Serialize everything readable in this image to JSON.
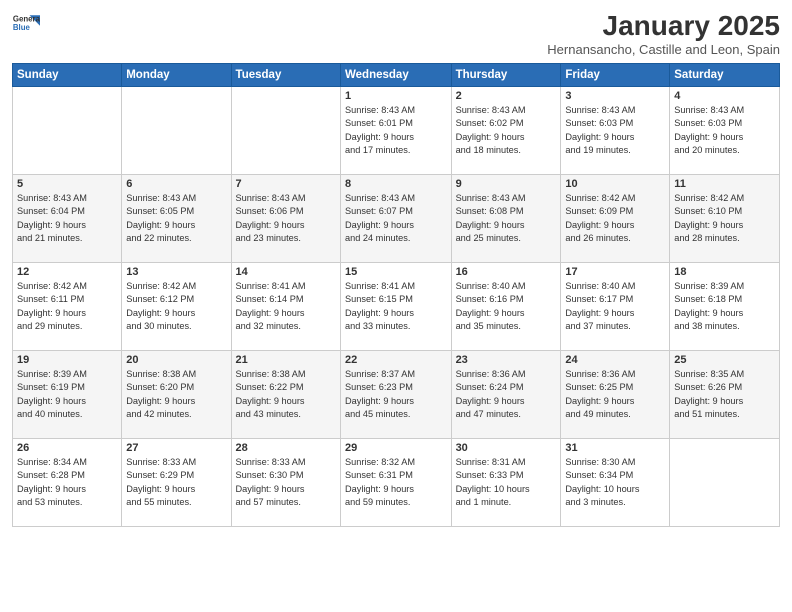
{
  "logo": {
    "line1": "General",
    "line2": "Blue"
  },
  "header": {
    "title": "January 2025",
    "location": "Hernansancho, Castille and Leon, Spain"
  },
  "weekdays": [
    "Sunday",
    "Monday",
    "Tuesday",
    "Wednesday",
    "Thursday",
    "Friday",
    "Saturday"
  ],
  "weeks": [
    [
      {
        "day": "",
        "info": ""
      },
      {
        "day": "",
        "info": ""
      },
      {
        "day": "",
        "info": ""
      },
      {
        "day": "1",
        "info": "Sunrise: 8:43 AM\nSunset: 6:01 PM\nDaylight: 9 hours\nand 17 minutes."
      },
      {
        "day": "2",
        "info": "Sunrise: 8:43 AM\nSunset: 6:02 PM\nDaylight: 9 hours\nand 18 minutes."
      },
      {
        "day": "3",
        "info": "Sunrise: 8:43 AM\nSunset: 6:03 PM\nDaylight: 9 hours\nand 19 minutes."
      },
      {
        "day": "4",
        "info": "Sunrise: 8:43 AM\nSunset: 6:03 PM\nDaylight: 9 hours\nand 20 minutes."
      }
    ],
    [
      {
        "day": "5",
        "info": "Sunrise: 8:43 AM\nSunset: 6:04 PM\nDaylight: 9 hours\nand 21 minutes."
      },
      {
        "day": "6",
        "info": "Sunrise: 8:43 AM\nSunset: 6:05 PM\nDaylight: 9 hours\nand 22 minutes."
      },
      {
        "day": "7",
        "info": "Sunrise: 8:43 AM\nSunset: 6:06 PM\nDaylight: 9 hours\nand 23 minutes."
      },
      {
        "day": "8",
        "info": "Sunrise: 8:43 AM\nSunset: 6:07 PM\nDaylight: 9 hours\nand 24 minutes."
      },
      {
        "day": "9",
        "info": "Sunrise: 8:43 AM\nSunset: 6:08 PM\nDaylight: 9 hours\nand 25 minutes."
      },
      {
        "day": "10",
        "info": "Sunrise: 8:42 AM\nSunset: 6:09 PM\nDaylight: 9 hours\nand 26 minutes."
      },
      {
        "day": "11",
        "info": "Sunrise: 8:42 AM\nSunset: 6:10 PM\nDaylight: 9 hours\nand 28 minutes."
      }
    ],
    [
      {
        "day": "12",
        "info": "Sunrise: 8:42 AM\nSunset: 6:11 PM\nDaylight: 9 hours\nand 29 minutes."
      },
      {
        "day": "13",
        "info": "Sunrise: 8:42 AM\nSunset: 6:12 PM\nDaylight: 9 hours\nand 30 minutes."
      },
      {
        "day": "14",
        "info": "Sunrise: 8:41 AM\nSunset: 6:14 PM\nDaylight: 9 hours\nand 32 minutes."
      },
      {
        "day": "15",
        "info": "Sunrise: 8:41 AM\nSunset: 6:15 PM\nDaylight: 9 hours\nand 33 minutes."
      },
      {
        "day": "16",
        "info": "Sunrise: 8:40 AM\nSunset: 6:16 PM\nDaylight: 9 hours\nand 35 minutes."
      },
      {
        "day": "17",
        "info": "Sunrise: 8:40 AM\nSunset: 6:17 PM\nDaylight: 9 hours\nand 37 minutes."
      },
      {
        "day": "18",
        "info": "Sunrise: 8:39 AM\nSunset: 6:18 PM\nDaylight: 9 hours\nand 38 minutes."
      }
    ],
    [
      {
        "day": "19",
        "info": "Sunrise: 8:39 AM\nSunset: 6:19 PM\nDaylight: 9 hours\nand 40 minutes."
      },
      {
        "day": "20",
        "info": "Sunrise: 8:38 AM\nSunset: 6:20 PM\nDaylight: 9 hours\nand 42 minutes."
      },
      {
        "day": "21",
        "info": "Sunrise: 8:38 AM\nSunset: 6:22 PM\nDaylight: 9 hours\nand 43 minutes."
      },
      {
        "day": "22",
        "info": "Sunrise: 8:37 AM\nSunset: 6:23 PM\nDaylight: 9 hours\nand 45 minutes."
      },
      {
        "day": "23",
        "info": "Sunrise: 8:36 AM\nSunset: 6:24 PM\nDaylight: 9 hours\nand 47 minutes."
      },
      {
        "day": "24",
        "info": "Sunrise: 8:36 AM\nSunset: 6:25 PM\nDaylight: 9 hours\nand 49 minutes."
      },
      {
        "day": "25",
        "info": "Sunrise: 8:35 AM\nSunset: 6:26 PM\nDaylight: 9 hours\nand 51 minutes."
      }
    ],
    [
      {
        "day": "26",
        "info": "Sunrise: 8:34 AM\nSunset: 6:28 PM\nDaylight: 9 hours\nand 53 minutes."
      },
      {
        "day": "27",
        "info": "Sunrise: 8:33 AM\nSunset: 6:29 PM\nDaylight: 9 hours\nand 55 minutes."
      },
      {
        "day": "28",
        "info": "Sunrise: 8:33 AM\nSunset: 6:30 PM\nDaylight: 9 hours\nand 57 minutes."
      },
      {
        "day": "29",
        "info": "Sunrise: 8:32 AM\nSunset: 6:31 PM\nDaylight: 9 hours\nand 59 minutes."
      },
      {
        "day": "30",
        "info": "Sunrise: 8:31 AM\nSunset: 6:33 PM\nDaylight: 10 hours\nand 1 minute."
      },
      {
        "day": "31",
        "info": "Sunrise: 8:30 AM\nSunset: 6:34 PM\nDaylight: 10 hours\nand 3 minutes."
      },
      {
        "day": "",
        "info": ""
      }
    ]
  ]
}
